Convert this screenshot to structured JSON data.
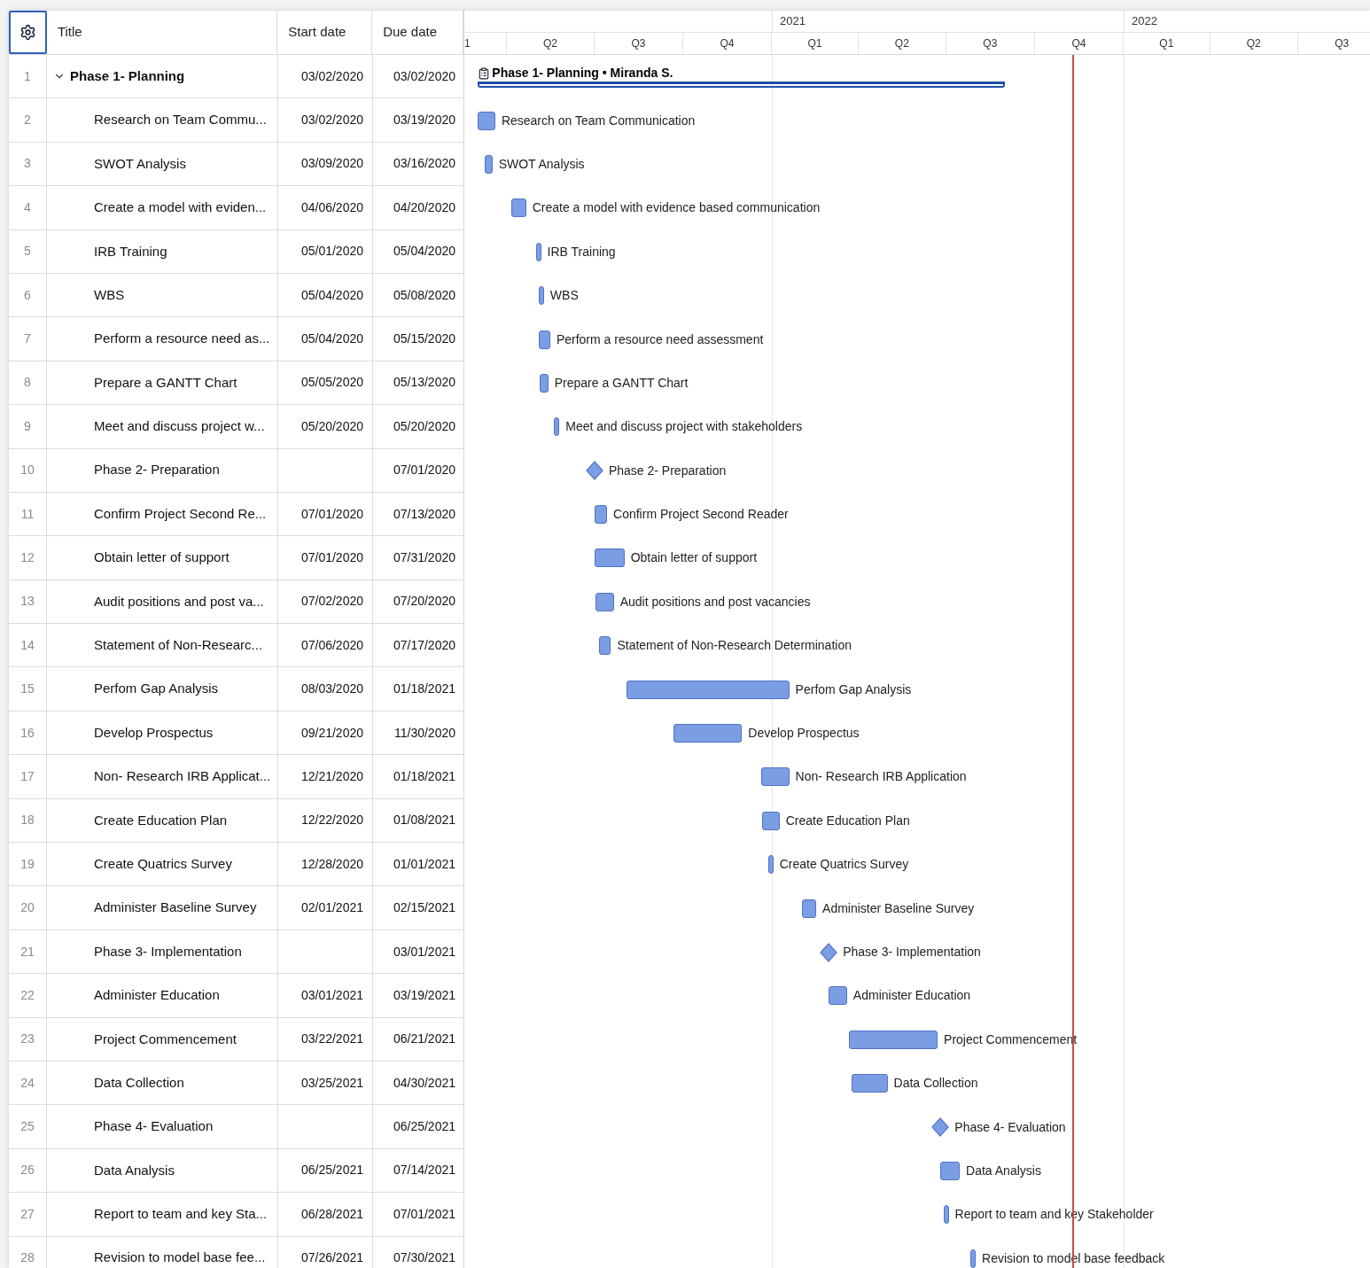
{
  "table": {
    "columns": [
      "Title",
      "Start date",
      "Due date"
    ]
  },
  "timeline": {
    "years": [
      "2021",
      "2022"
    ],
    "quarters": [
      "1",
      "Q2",
      "Q3",
      "Q4",
      "Q1",
      "Q2",
      "Q3",
      "Q4",
      "Q1",
      "Q2",
      "Q3"
    ]
  },
  "rows": [
    {
      "number": "1",
      "kind": "phase",
      "expanded": true,
      "title": "Phase 1- Planning",
      "start": "03/02/2020",
      "due": "03/02/2020",
      "bar_label": "Phase 1- Planning • Miranda S."
    },
    {
      "number": "2",
      "kind": "task",
      "title": "Research on Team Commu...",
      "start": "03/02/2020",
      "due": "03/19/2020",
      "bar_label": "Research on Team Communication"
    },
    {
      "number": "3",
      "kind": "task",
      "title": "SWOT Analysis",
      "start": "03/09/2020",
      "due": "03/16/2020",
      "bar_label": "SWOT Analysis"
    },
    {
      "number": "4",
      "kind": "task",
      "title": "Create a model with eviden...",
      "start": "04/06/2020",
      "due": "04/20/2020",
      "bar_label": "Create a model with evidence based communication"
    },
    {
      "number": "5",
      "kind": "task",
      "title": "IRB Training",
      "start": "05/01/2020",
      "due": "05/04/2020",
      "bar_label": "IRB Training"
    },
    {
      "number": "6",
      "kind": "task",
      "title": "WBS",
      "start": "05/04/2020",
      "due": "05/08/2020",
      "bar_label": "WBS"
    },
    {
      "number": "7",
      "kind": "task",
      "title": "Perform a resource need as...",
      "start": "05/04/2020",
      "due": "05/15/2020",
      "bar_label": "Perform a resource need assessment"
    },
    {
      "number": "8",
      "kind": "task",
      "title": "Prepare a GANTT Chart",
      "start": "05/05/2020",
      "due": "05/13/2020",
      "bar_label": "Prepare a GANTT Chart"
    },
    {
      "number": "9",
      "kind": "task",
      "title": "Meet and discuss project w...",
      "start": "05/20/2020",
      "due": "05/20/2020",
      "bar_label": "Meet and discuss project with stakeholders"
    },
    {
      "number": "10",
      "kind": "milestone",
      "title": "Phase 2- Preparation",
      "due": "07/01/2020",
      "bar_label": "Phase 2- Preparation"
    },
    {
      "number": "11",
      "kind": "task",
      "title": "Confirm Project Second Re...",
      "start": "07/01/2020",
      "due": "07/13/2020",
      "bar_label": "Confirm Project Second Reader"
    },
    {
      "number": "12",
      "kind": "task",
      "title": "Obtain letter of support",
      "start": "07/01/2020",
      "due": "07/31/2020",
      "bar_label": "Obtain letter of support"
    },
    {
      "number": "13",
      "kind": "task",
      "title": "Audit positions and post va...",
      "start": "07/02/2020",
      "due": "07/20/2020",
      "bar_label": "Audit positions and post vacancies"
    },
    {
      "number": "14",
      "kind": "task",
      "title": "Statement of Non-Researc...",
      "start": "07/06/2020",
      "due": "07/17/2020",
      "bar_label": "Statement of Non-Research Determination"
    },
    {
      "number": "15",
      "kind": "task",
      "title": "Perfom Gap Analysis",
      "start": "08/03/2020",
      "due": "01/18/2021",
      "bar_label": "Perfom Gap Analysis"
    },
    {
      "number": "16",
      "kind": "task",
      "title": "Develop Prospectus",
      "start": "09/21/2020",
      "due": "11/30/2020",
      "bar_label": "Develop Prospectus"
    },
    {
      "number": "17",
      "kind": "task",
      "title": "Non- Research IRB Applicat...",
      "start": "12/21/2020",
      "due": "01/18/2021",
      "bar_label": "Non- Research IRB Application"
    },
    {
      "number": "18",
      "kind": "task",
      "title": "Create Education Plan",
      "start": "12/22/2020",
      "due": "01/08/2021",
      "bar_label": "Create Education Plan"
    },
    {
      "number": "19",
      "kind": "task",
      "title": "Create Quatrics Survey",
      "start": "12/28/2020",
      "due": "01/01/2021",
      "bar_label": "Create Quatrics Survey"
    },
    {
      "number": "20",
      "kind": "task",
      "title": "Administer Baseline Survey",
      "start": "02/01/2021",
      "due": "02/15/2021",
      "bar_label": "Administer Baseline Survey"
    },
    {
      "number": "21",
      "kind": "milestone",
      "title": "Phase 3- Implementation",
      "due": "03/01/2021",
      "bar_label": "Phase 3- Implementation"
    },
    {
      "number": "22",
      "kind": "task",
      "title": "Administer Education",
      "start": "03/01/2021",
      "due": "03/19/2021",
      "bar_label": "Administer Education"
    },
    {
      "number": "23",
      "kind": "task",
      "title": "Project Commencement",
      "start": "03/22/2021",
      "due": "06/21/2021",
      "bar_label": "Project Commencement"
    },
    {
      "number": "24",
      "kind": "task",
      "title": "Data Collection",
      "start": "03/25/2021",
      "due": "04/30/2021",
      "bar_label": "Data Collection"
    },
    {
      "number": "25",
      "kind": "milestone",
      "title": "Phase 4- Evaluation",
      "due": "06/25/2021",
      "bar_label": "Phase 4- Evaluation"
    },
    {
      "number": "26",
      "kind": "task",
      "title": "Data Analysis",
      "start": "06/25/2021",
      "due": "07/14/2021",
      "bar_label": "Data Analysis"
    },
    {
      "number": "27",
      "kind": "task",
      "title": "Report to team and key Sta...",
      "start": "06/28/2021",
      "due": "07/01/2021",
      "bar_label": "Report to team and key Stakeholder"
    },
    {
      "number": "28",
      "kind": "task",
      "title": "Revision to model base fee...",
      "start": "07/26/2021",
      "due": "07/30/2021",
      "bar_label": "Revision to model base feedback"
    }
  ]
}
